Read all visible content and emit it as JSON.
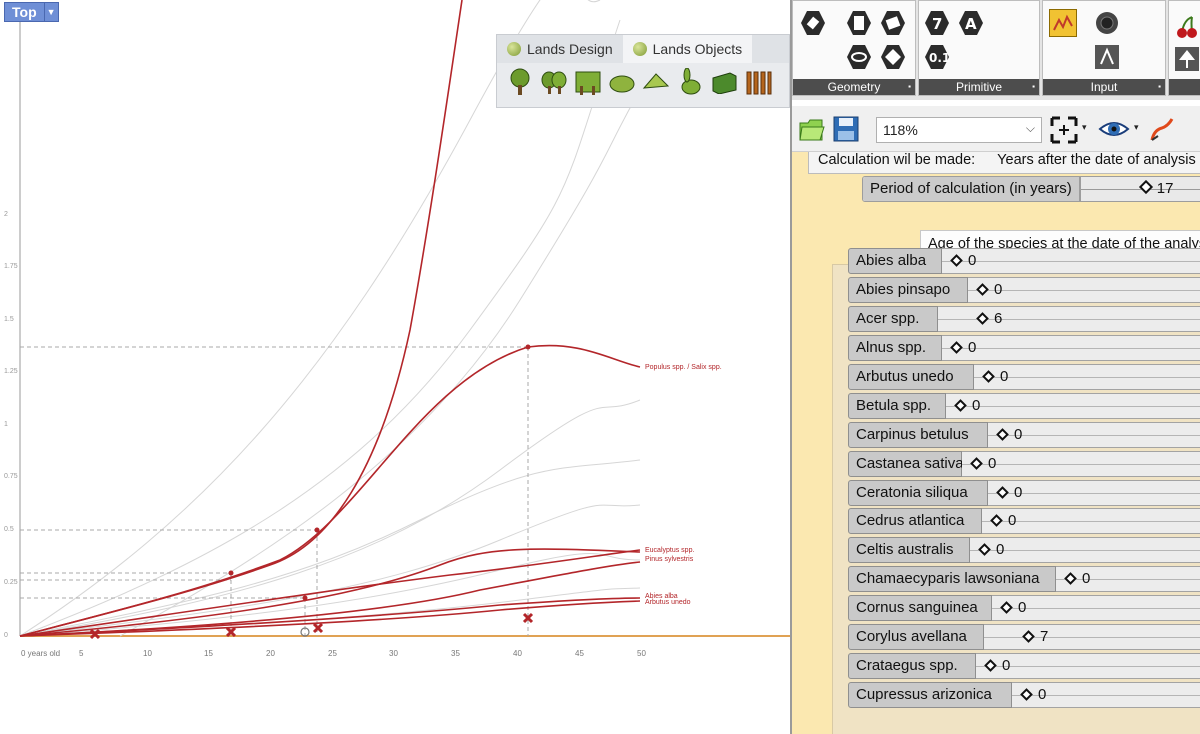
{
  "viewport": {
    "label": "Top",
    "x_ticks": [
      "0 years old",
      "5",
      "10",
      "15",
      "20",
      "25",
      "30",
      "35",
      "40",
      "45",
      "50"
    ],
    "y_ticks": [
      "2",
      "1.75",
      "1.5",
      "1.25",
      "1",
      "0.75",
      "0.5",
      "0.25",
      "0"
    ],
    "curve_labels": [
      "Populus spp. / Salix spp.",
      "Eucalyptus spp.",
      "Pinus sylvestris",
      "Abies alba",
      "Arbutus unedo"
    ],
    "curve_color": "#b3262a"
  },
  "lands_toolbar": {
    "tabs": [
      "Lands Design",
      "Lands Objects"
    ],
    "active_tab": "Lands Objects",
    "icons": [
      "tree-icon",
      "hedge-icon",
      "tree-row-icon",
      "shrub-icon",
      "plant-icon",
      "rabbit-icon",
      "wall-icon",
      "fence-icon"
    ]
  },
  "gh": {
    "groups": [
      "Geometry",
      "Primitive",
      "Input"
    ],
    "zoom": "118%",
    "calc_label": "Calculation wil be made:",
    "calc_value": "Years after the date of analysis",
    "period_label": "Period of calculation (in years)",
    "period_value": "17",
    "age_label": "Age of the species at the date of the analysis",
    "species": [
      {
        "name": "Abies alba",
        "value": "0"
      },
      {
        "name": "Abies pinsapo",
        "value": "0"
      },
      {
        "name": "Acer spp.",
        "value": "6"
      },
      {
        "name": "Alnus spp.",
        "value": "0"
      },
      {
        "name": "Arbutus unedo",
        "value": "0"
      },
      {
        "name": "Betula spp.",
        "value": "0"
      },
      {
        "name": "Carpinus betulus",
        "value": "0"
      },
      {
        "name": "Castanea sativa",
        "value": "0"
      },
      {
        "name": "Ceratonia siliqua",
        "value": "0"
      },
      {
        "name": "Cedrus atlantica",
        "value": "0"
      },
      {
        "name": "Celtis australis",
        "value": "0"
      },
      {
        "name": "Chamaecyparis lawsoniana",
        "value": "0"
      },
      {
        "name": "Cornus sanguinea",
        "value": "0"
      },
      {
        "name": "Corylus avellana",
        "value": "7"
      },
      {
        "name": "Crataegus spp.",
        "value": "0"
      },
      {
        "name": "Cupressus arizonica",
        "value": "0"
      }
    ]
  }
}
